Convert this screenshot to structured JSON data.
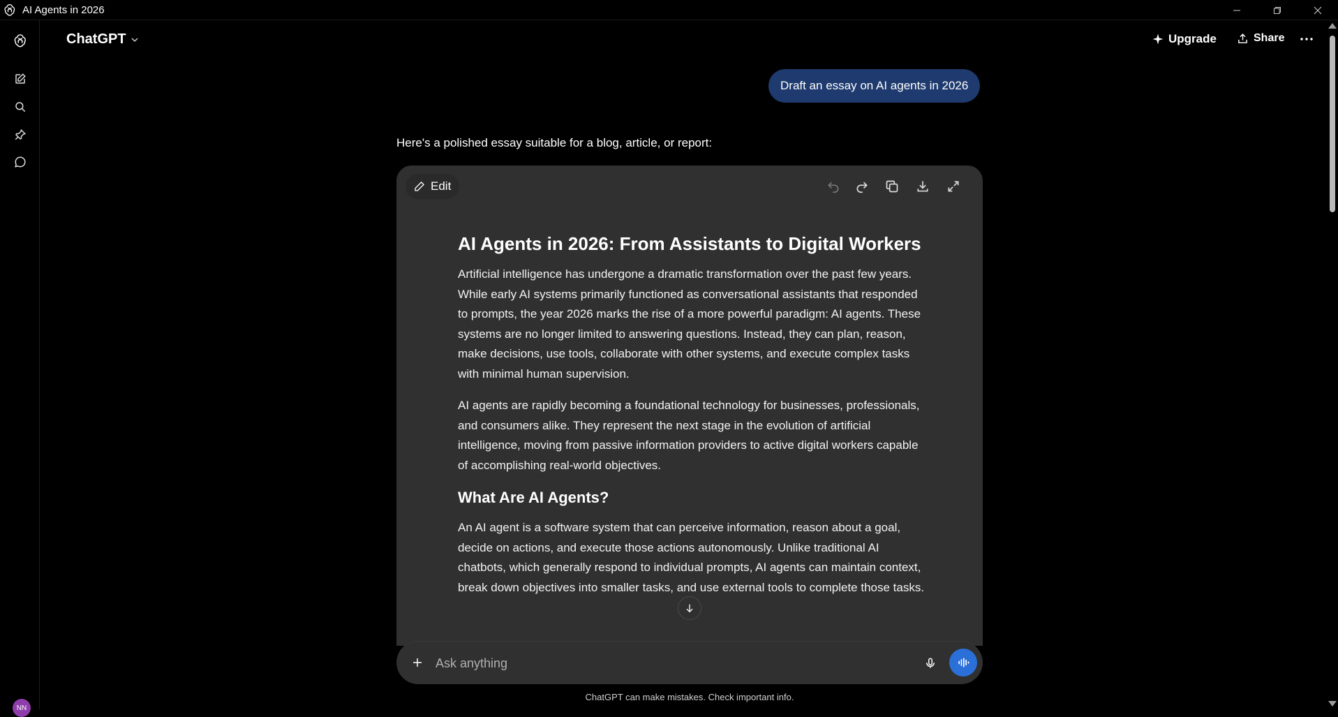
{
  "window": {
    "title": "AI Agents in 2026"
  },
  "header": {
    "model_label": "ChatGPT",
    "upgrade_label": "Upgrade",
    "share_label": "Share"
  },
  "sidebar": {
    "avatar_initials": "NN",
    "icons": [
      "new-chat-icon",
      "search-icon",
      "pin-icon",
      "chat-bubble-icon"
    ]
  },
  "conversation": {
    "user_message": "Draft an essay on AI agents in 2026",
    "assistant_intro": "Here's a polished essay suitable for a blog, article, or report:"
  },
  "canvas": {
    "edit_label": "Edit",
    "title": "AI Agents in 2026: From Assistants to Digital Workers",
    "paragraph_1": "Artificial intelligence has undergone a dramatic transformation over the past few years. While early AI systems primarily functioned as conversational assistants that responded to prompts, the year 2026 marks the rise of a more powerful paradigm: AI agents. These systems are no longer limited to answering questions. Instead, they can plan, reason, make decisions, use tools, collaborate with other systems, and execute complex tasks with minimal human supervision.",
    "paragraph_2": "AI agents are rapidly becoming a foundational technology for businesses, professionals, and consumers alike. They represent the next stage in the evolution of artificial intelligence, moving from passive information providers to active digital workers capable of accomplishing real-world objectives.",
    "heading_2": "What Are AI Agents?",
    "paragraph_3": "An AI agent is a software system that can perceive information, reason about a goal, decide on actions, and execute those actions autonomously. Unlike traditional AI chatbots, which generally respond to individual prompts, AI agents can maintain context, break down objectives into smaller tasks, and use external tools to complete those tasks."
  },
  "composer": {
    "placeholder": "Ask anything",
    "value": ""
  },
  "footer": {
    "disclaimer": "ChatGPT can make mistakes. Check important info."
  },
  "colors": {
    "background": "#000000",
    "card": "#303030",
    "user_bubble": "#1e3a6e",
    "voice_button": "#2b6fd8",
    "avatar": "#8e3dab"
  }
}
